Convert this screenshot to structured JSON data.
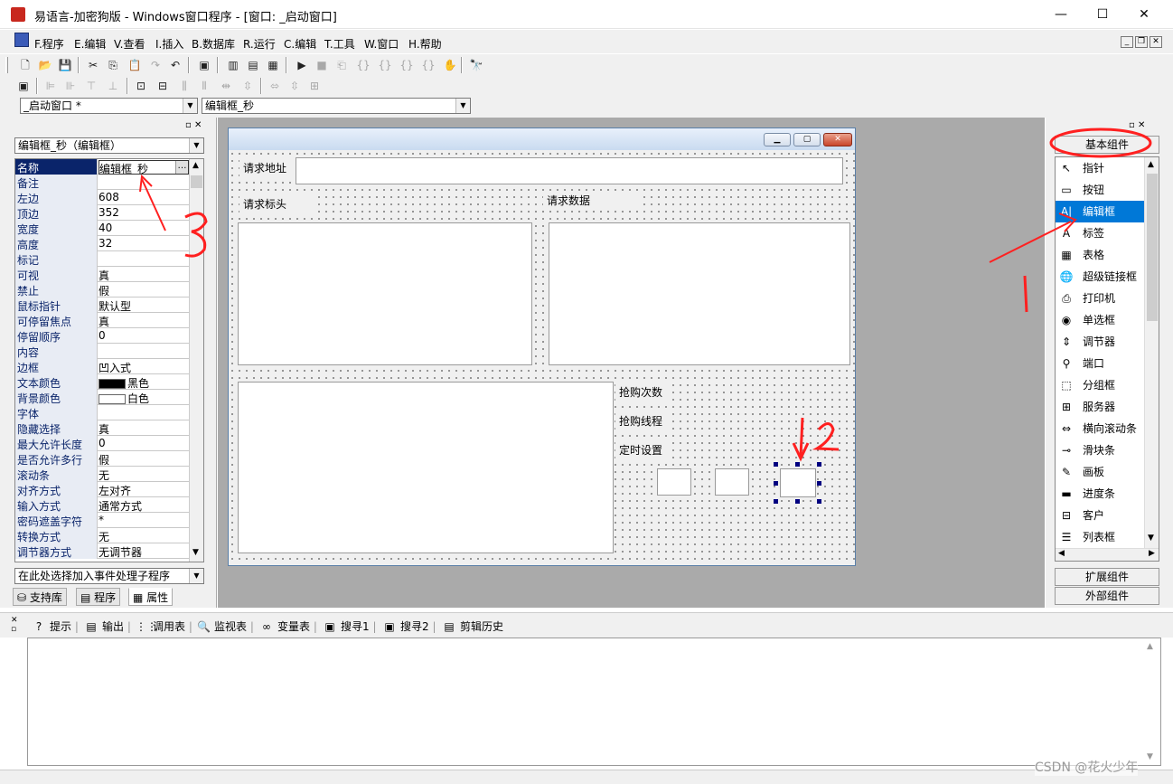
{
  "window": {
    "title": "易语言-加密狗版 - Windows窗口程序 - [窗口: _启动窗口]",
    "min": "—",
    "max": "☐",
    "close": "✕"
  },
  "menu": {
    "items": [
      "F.程序",
      "E.编辑",
      "V.查看",
      "I.插入",
      "B.数据库",
      "R.运行",
      "C.编辑",
      "T.工具",
      "W.窗口",
      "H.帮助"
    ]
  },
  "toolbar1": {
    "icons": [
      "new-icon",
      "open-icon",
      "save-icon",
      "cut-icon",
      "copy-icon",
      "paste-icon",
      "redo-icon",
      "undo-icon",
      "find-icon",
      "layout1-icon",
      "layout2-icon",
      "layout3-icon",
      "run-icon",
      "stop-icon",
      "step1-icon",
      "step2-icon",
      "step3-icon",
      "step4-icon",
      "step5-icon",
      "hand-icon",
      "binoculars-icon"
    ]
  },
  "combos": {
    "window_select": "_启动窗口 *",
    "component_select": "编辑框_秒"
  },
  "property_panel": {
    "object_select": "编辑框_秒（编辑框）",
    "properties": [
      {
        "name": "名称",
        "value": "编辑框_秒",
        "selected": true
      },
      {
        "name": "备注",
        "value": ""
      },
      {
        "name": "左边",
        "value": "608"
      },
      {
        "name": "顶边",
        "value": "352"
      },
      {
        "name": "宽度",
        "value": "40"
      },
      {
        "name": "高度",
        "value": "32"
      },
      {
        "name": "标记",
        "value": ""
      },
      {
        "name": "可视",
        "value": "真"
      },
      {
        "name": "禁止",
        "value": "假"
      },
      {
        "name": "鼠标指针",
        "value": "默认型"
      },
      {
        "name": "可停留焦点",
        "value": "真"
      },
      {
        "name": "停留顺序",
        "value": "0"
      },
      {
        "name": "内容",
        "value": ""
      },
      {
        "name": "边框",
        "value": "凹入式"
      },
      {
        "name": "文本颜色",
        "value": "黑色",
        "swatch": "#000000"
      },
      {
        "name": "背景颜色",
        "value": "白色",
        "swatch": "#ffffff"
      },
      {
        "name": "字体",
        "value": ""
      },
      {
        "name": "隐藏选择",
        "value": "真"
      },
      {
        "name": "最大允许长度",
        "value": "0"
      },
      {
        "name": "是否允许多行",
        "value": "假"
      },
      {
        "name": "滚动条",
        "value": "无"
      },
      {
        "name": "对齐方式",
        "value": "左对齐"
      },
      {
        "name": "输入方式",
        "value": "通常方式"
      },
      {
        "name": "密码遮盖字符",
        "value": "*"
      },
      {
        "name": "转换方式",
        "value": "无"
      },
      {
        "name": "调节器方式",
        "value": "无调节器"
      }
    ],
    "event_select": "在此处选择加入事件处理子程序",
    "tabs": [
      "支持库",
      "程序",
      "属性"
    ]
  },
  "form": {
    "labels": {
      "request_url": "请求地址",
      "request_header": "请求标头",
      "request_data": "请求数据",
      "buy_count": "抢购次数",
      "buy_threads": "抢购线程",
      "timer_setting": "定时设置"
    }
  },
  "components": {
    "category_basic": "基本组件",
    "items": [
      {
        "icon": "pointer-icon",
        "glyph": "↖",
        "label": "指针"
      },
      {
        "icon": "button-icon",
        "glyph": "▭",
        "label": "按钮"
      },
      {
        "icon": "editbox-icon",
        "glyph": "A|",
        "label": "编辑框",
        "selected": true
      },
      {
        "icon": "label-icon",
        "glyph": "A",
        "label": "标签"
      },
      {
        "icon": "grid-icon",
        "glyph": "▦",
        "label": "表格"
      },
      {
        "icon": "hyperlink-icon",
        "glyph": "🌐",
        "label": "超级链接框"
      },
      {
        "icon": "printer-icon",
        "glyph": "⎙",
        "label": "打印机"
      },
      {
        "icon": "radio-icon",
        "glyph": "◉",
        "label": "单选框"
      },
      {
        "icon": "spinner-icon",
        "glyph": "⇕",
        "label": "调节器"
      },
      {
        "icon": "port-icon",
        "glyph": "⚲",
        "label": "端口"
      },
      {
        "icon": "groupbox-icon",
        "glyph": "⬚",
        "label": "分组框"
      },
      {
        "icon": "server-icon",
        "glyph": "⊞",
        "label": "服务器"
      },
      {
        "icon": "hscroll-icon",
        "glyph": "⇔",
        "label": "横向滚动条"
      },
      {
        "icon": "slider-icon",
        "glyph": "⊸",
        "label": "滑块条"
      },
      {
        "icon": "picture-icon",
        "glyph": "✎",
        "label": "画板"
      },
      {
        "icon": "progress-icon",
        "glyph": "▬",
        "label": "进度条"
      },
      {
        "icon": "client-icon",
        "glyph": "⊟",
        "label": "客户"
      },
      {
        "icon": "listbox-icon",
        "glyph": "☰",
        "label": "列表框"
      }
    ],
    "category_extended": "扩展组件",
    "category_external": "外部组件"
  },
  "bottom_tabs": [
    {
      "icon": "hint-icon",
      "glyph": "?",
      "label": "提示"
    },
    {
      "icon": "output-icon",
      "glyph": "▤",
      "label": "输出"
    },
    {
      "icon": "callstack-icon",
      "glyph": "⋮⋮",
      "label": "调用表"
    },
    {
      "icon": "watch-icon",
      "glyph": "🔍",
      "label": "监视表"
    },
    {
      "icon": "variables-icon",
      "glyph": "∞",
      "label": "变量表"
    },
    {
      "icon": "search1-icon",
      "glyph": "▣",
      "label": "搜寻1"
    },
    {
      "icon": "search2-icon",
      "glyph": "▣",
      "label": "搜寻2"
    },
    {
      "icon": "cliphistory-icon",
      "glyph": "▤",
      "label": "剪辑历史"
    }
  ],
  "watermark": "CSDN @花火少年",
  "annotation_colors": {
    "red": "#ff2020"
  }
}
